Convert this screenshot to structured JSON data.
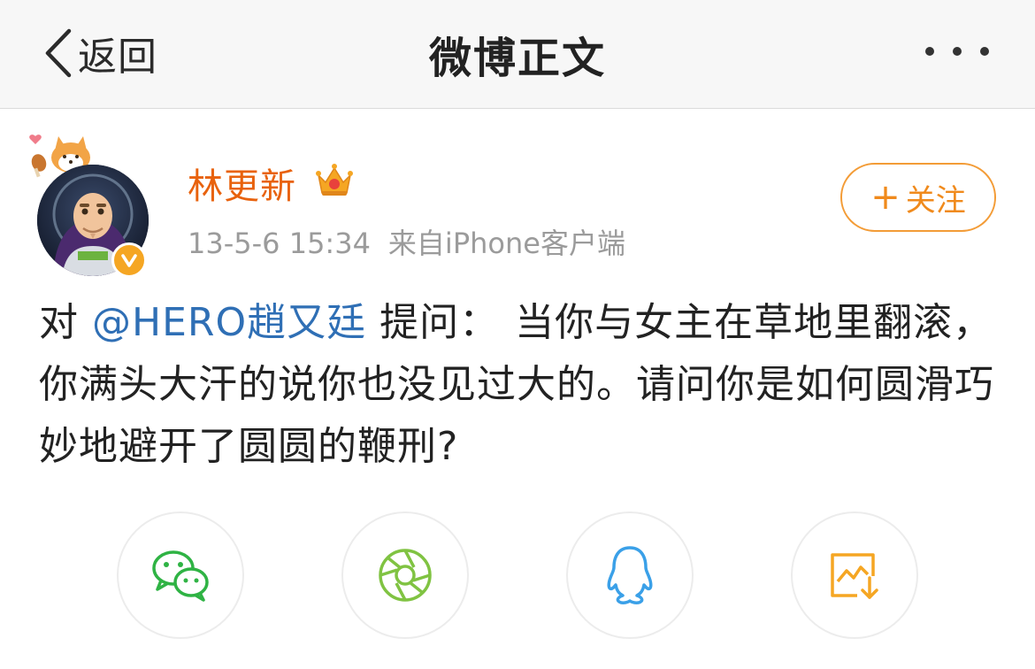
{
  "nav": {
    "back_label": "返回",
    "title": "微博正文",
    "more_icon": "more-dots-icon"
  },
  "author": {
    "name": "林更新",
    "time": "13-5-6 15:34",
    "source": "来自iPhone客户端",
    "verified": true,
    "accent_color": "#e8620d"
  },
  "follow": {
    "plus": "+",
    "label": "关注",
    "color": "#f08a1c"
  },
  "post": {
    "prefix": "对",
    "mention": "@HERO趙又廷",
    "action": "提问：",
    "question": "当你与女主在草地里翻滚，你满头大汗的说你也没见过大的。请问你是如何圆滑巧妙地避开了圆圆的鞭刑?",
    "mention_color": "#2f6fb5"
  },
  "share": {
    "items": [
      {
        "name": "wechat",
        "icon": "wechat-icon",
        "color": "#2fb344"
      },
      {
        "name": "moments",
        "icon": "moments-icon",
        "color": "#80c342"
      },
      {
        "name": "qq",
        "icon": "qq-icon",
        "color": "#3aa0e8"
      },
      {
        "name": "save-image",
        "icon": "save-image-icon",
        "color": "#f5a623"
      }
    ]
  }
}
